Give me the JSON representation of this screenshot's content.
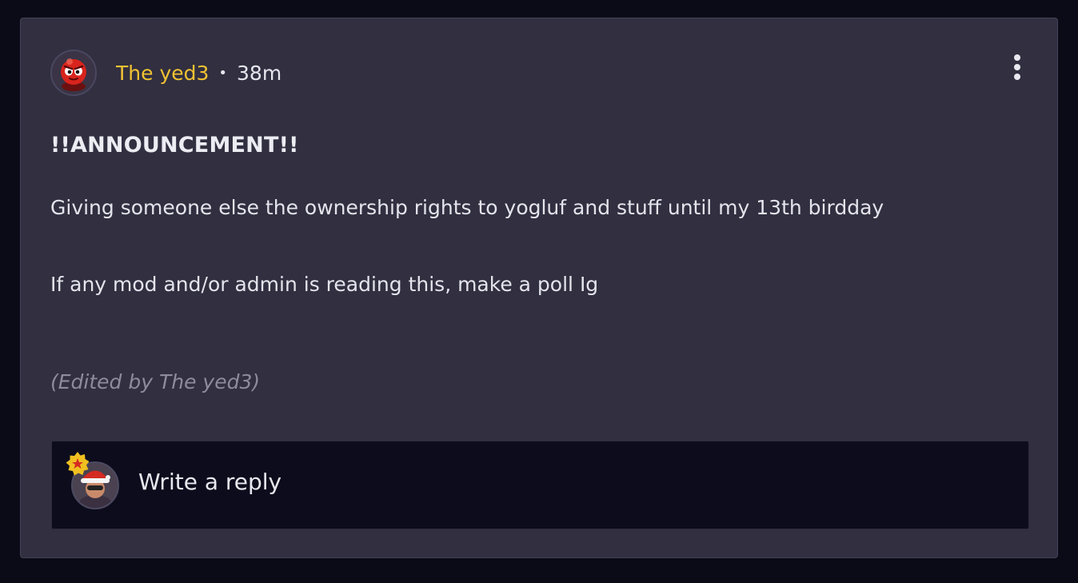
{
  "post": {
    "author": "The yed3",
    "separator": "•",
    "time": "38m",
    "title": "!!ANNOUNCEMENT!!",
    "paragraphs": [
      "Giving someone else the ownership rights to yogluf and stuff until my 13th birdday",
      "If any mod and/or admin is reading this, make a poll Ig"
    ],
    "edited_note": "(Edited by The yed3)"
  },
  "reply": {
    "placeholder": "Write a reply"
  },
  "colors": {
    "author": "#f1c232",
    "card_bg": "#312f40",
    "page_bg": "#0b0b17",
    "reply_bg": "#0c0c1c"
  },
  "icons": {
    "author_avatar": "red-blob-avatar",
    "more": "more-vertical-icon",
    "reply_avatar": "santa-hat-avatar",
    "badge": "star-badge-icon"
  }
}
